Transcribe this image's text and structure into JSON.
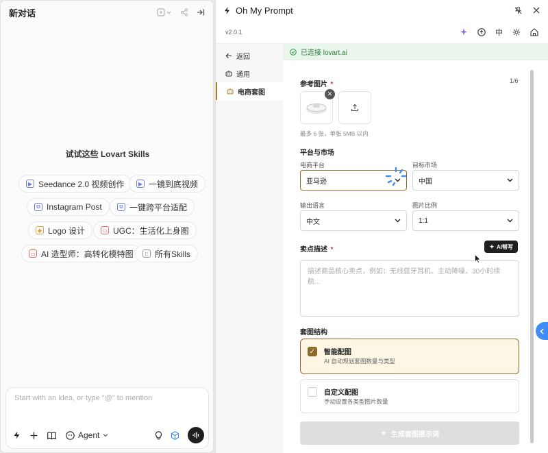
{
  "left": {
    "title": "新对话",
    "skills_title": "试试这些 Lovart Skills",
    "chips": [
      {
        "label": "Seedance 2.0 视频创作",
        "icon": "video-icon"
      },
      {
        "label": "一镜到底视频",
        "icon": "video-icon"
      },
      {
        "label": "Instagram Post",
        "icon": "copy-icon"
      },
      {
        "label": "一键跨平台适配",
        "icon": "copy-icon"
      },
      {
        "label": "Logo 设计",
        "icon": "logo-icon"
      },
      {
        "label": "UGC：生活化上身图",
        "icon": "image-icon"
      },
      {
        "label": "AI 造型师：高转化模特图",
        "icon": "image-icon"
      },
      {
        "label": "所有Skills",
        "icon": "book-icon"
      }
    ],
    "composer": {
      "placeholder": "Start with an idea, or type \"@\" to mention",
      "agent_label": "Agent"
    }
  },
  "right": {
    "title": "Oh My Prompt",
    "version": "v2.0.1",
    "lang_label": "中",
    "sidebar": [
      {
        "label": "返回",
        "icon": "arrow-left-icon"
      },
      {
        "label": "通用",
        "icon": "bot-icon"
      },
      {
        "label": "电商套图",
        "icon": "bot-icon"
      }
    ],
    "banner": "已连接 lovart.ai",
    "ref_images": {
      "label": "参考图片",
      "required": "*",
      "count": "1/6",
      "hint": "最多 6 张，单张 5MB 以内"
    },
    "platform_section": "平台与市场",
    "platform": {
      "label": "电商平台",
      "value": "亚马逊"
    },
    "market": {
      "label": "目标市场",
      "value": "中国"
    },
    "language": {
      "label": "输出语言",
      "value": "中文"
    },
    "ratio": {
      "label": "图片比例",
      "value": "1:1"
    },
    "selling": {
      "label": "卖点描述",
      "required": "*",
      "ai_button": "AI帮写",
      "placeholder": "描述商品核心卖点，例如：无线蓝牙耳机、主动降噪、30小时续航..."
    },
    "structure": {
      "label": "套图结构",
      "options": [
        {
          "title": "智能配图",
          "desc": "AI 自动规划套图数量与类型",
          "checked": true
        },
        {
          "title": "自定义配图",
          "desc": "手动设置各类型图片数量",
          "checked": false
        }
      ]
    },
    "generate_button": "生成套图提示词",
    "accent_color": "#8a6a2a",
    "link_color": "#3e8cf5"
  }
}
